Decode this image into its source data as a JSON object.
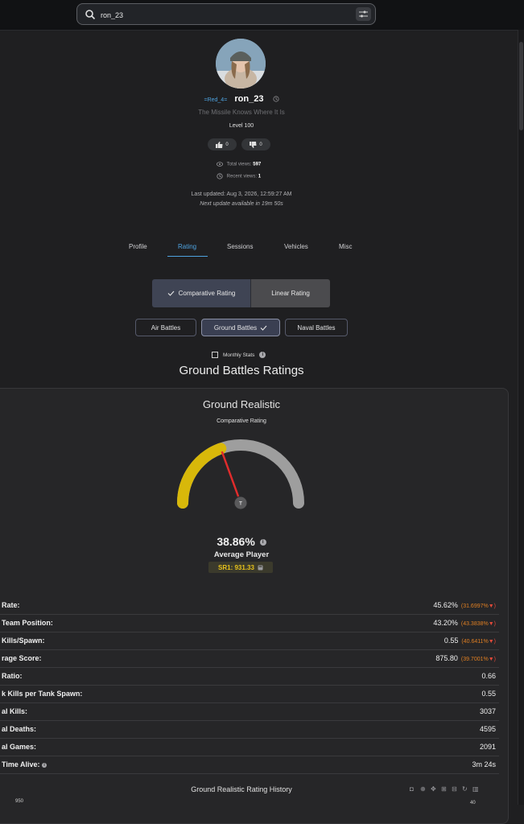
{
  "search": {
    "value": "ron_23"
  },
  "profile": {
    "clan_tag": "=Red_4=",
    "username": "ron_23",
    "title": "The Missile Knows Where It Is",
    "level": "Level 100",
    "likes": "0",
    "dislikes": "0",
    "total_views_label": "Total views:",
    "total_views": "597",
    "recent_views_label": "Recent views:",
    "recent_views": "1",
    "last_updated": "Last updated: Aug 3, 2026, 12:59:27 AM",
    "next_update": "Next update available in 19m 50s"
  },
  "tabs": [
    "Profile",
    "Rating",
    "Sessions",
    "Vehicles",
    "Misc"
  ],
  "active_tab": "Rating",
  "rating_type": {
    "comparative": "Comparative Rating",
    "linear": "Linear Rating",
    "selected": "Comparative Rating"
  },
  "modes": {
    "air": "Air Battles",
    "ground": "Ground Battles",
    "naval": "Naval Battles",
    "selected": "Ground Battles"
  },
  "monthly_stats": {
    "label": "Monthly Stats",
    "checked": false
  },
  "section_title": "Ground Battles Ratings",
  "card": {
    "title": "Ground Realistic",
    "subtitle": "Comparative Rating",
    "gauge_needle_label": "T",
    "gauge_fraction": 0.3886,
    "colors": {
      "gauge_fill": "#d8b80a",
      "gauge_track": "#9e9e9e",
      "needle": "#e02c2c"
    },
    "percent": "38.86%",
    "tier": "Average Player",
    "sr1": "SR1: 931.33"
  },
  "stats": [
    {
      "label": "Rate:",
      "value": "45.62%",
      "change": "(31.6997%",
      "arrow": "▼)"
    },
    {
      "label": "Team Position:",
      "value": "43.20%",
      "change": "(43.3838%",
      "arrow": "▼)"
    },
    {
      "label": "Kills/Spawn:",
      "value": "0.55",
      "change": "(40.6411%",
      "arrow": "▼)"
    },
    {
      "label": "rage Score:",
      "value": "875.80",
      "change": "(39.7001%",
      "arrow": "▼)"
    },
    {
      "label": "Ratio:",
      "value": "0.66"
    },
    {
      "label": "k Kills per Tank Spawn:",
      "value": "0.55"
    },
    {
      "label": "al Kills:",
      "value": "3037"
    },
    {
      "label": "al Deaths:",
      "value": "4595"
    },
    {
      "label": "al Games:",
      "value": "2091"
    },
    {
      "label": "Time Alive:",
      "value": "3m 24s"
    }
  ],
  "history": {
    "title": "Ground Realistic Rating History",
    "y_top": "950",
    "y_right": "40"
  }
}
